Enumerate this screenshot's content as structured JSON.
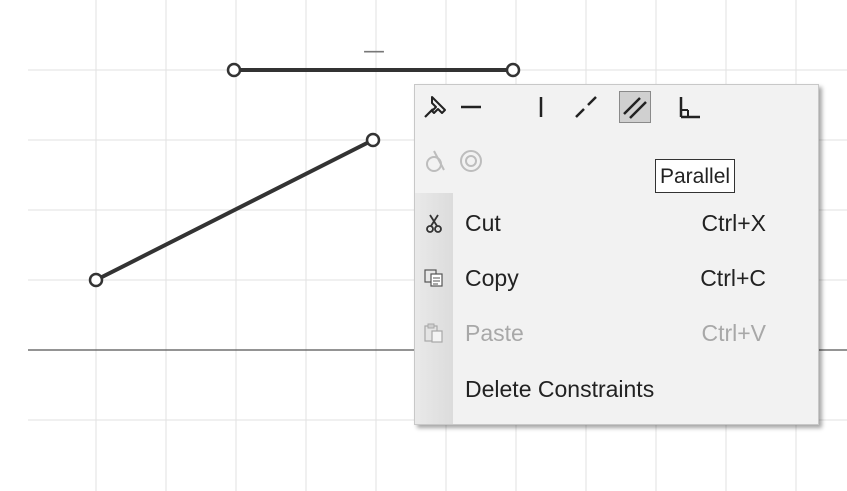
{
  "toolbar": {
    "tools": [
      {
        "name": "fix-pin-icon",
        "selected": false,
        "enabled": true
      },
      {
        "name": "horizontal-icon",
        "selected": false,
        "enabled": true
      },
      {
        "name": "vertical-icon",
        "selected": false,
        "enabled": true
      },
      {
        "name": "collinear-icon",
        "selected": false,
        "enabled": true
      },
      {
        "name": "parallel-icon",
        "selected": true,
        "enabled": true
      },
      {
        "name": "perpendicular-icon",
        "selected": false,
        "enabled": true
      },
      {
        "name": "tangent-icon",
        "selected": false,
        "enabled": false
      },
      {
        "name": "concentric-icon",
        "selected": false,
        "enabled": false
      }
    ]
  },
  "tooltip": {
    "text": "Parallel"
  },
  "menu": {
    "items": [
      {
        "label": "Cut",
        "shortcut": "Ctrl+X",
        "icon": "scissors-icon",
        "enabled": true
      },
      {
        "label": "Copy",
        "shortcut": "Ctrl+C",
        "icon": "copy-icon",
        "enabled": true
      },
      {
        "label": "Paste",
        "shortcut": "Ctrl+V",
        "icon": "paste-icon",
        "enabled": false
      },
      {
        "label": "Delete Constraints",
        "shortcut": "",
        "icon": "",
        "enabled": true
      }
    ]
  },
  "canvas": {
    "horizontal_constraint_glyph": "—"
  },
  "colors": {
    "grid": "#e2e2e2",
    "axis": "#555555",
    "sketch_line": "#333333",
    "menu_bg": "#f2f2f2",
    "disabled_text": "#a8a8a8"
  }
}
